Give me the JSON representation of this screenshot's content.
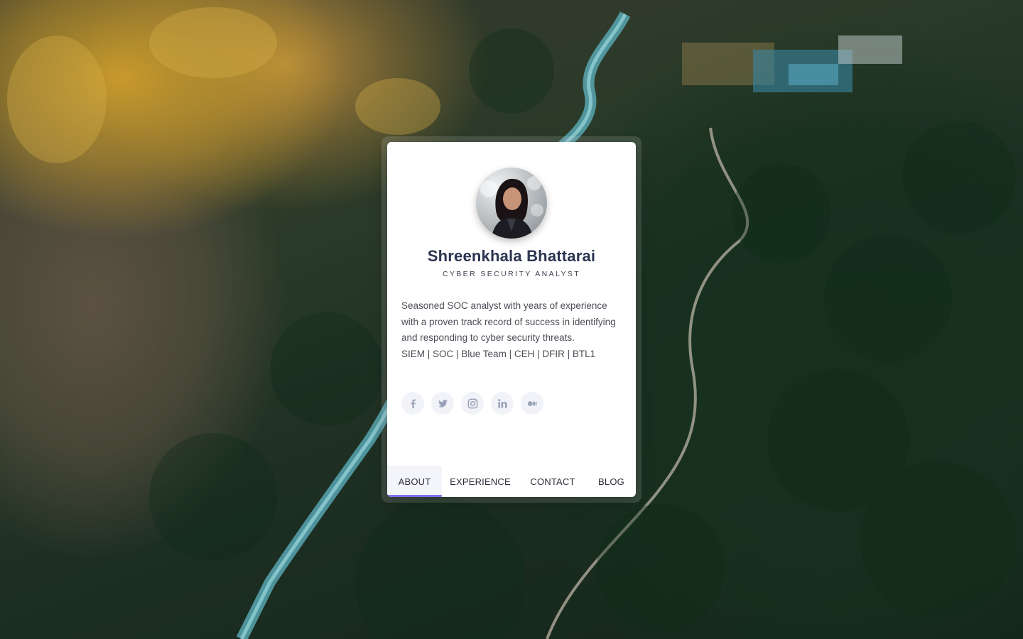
{
  "profile": {
    "name": "Shreenkhala Bhattarai",
    "role": "CYBER SECURITY ANALYST",
    "bio": "Seasoned SOC analyst with years of experience with a proven track record of success in identifying and responding to cyber security threats.",
    "skills": "SIEM | SOC | Blue Team | CEH | DFIR | BTL1"
  },
  "social": [
    {
      "icon": "facebook-icon"
    },
    {
      "icon": "twitter-icon"
    },
    {
      "icon": "instagram-icon"
    },
    {
      "icon": "linkedin-icon"
    },
    {
      "icon": "medium-icon"
    }
  ],
  "tabs": [
    {
      "label": "ABOUT",
      "active": true
    },
    {
      "label": "EXPERIENCE",
      "active": false
    },
    {
      "label": "CONTACT",
      "active": false
    },
    {
      "label": "BLOG",
      "active": false
    }
  ],
  "colors": {
    "accent": "#7f6ff0",
    "name_text": "#2c3550",
    "icon": "#9aa2b8",
    "card": "#ffffff"
  }
}
